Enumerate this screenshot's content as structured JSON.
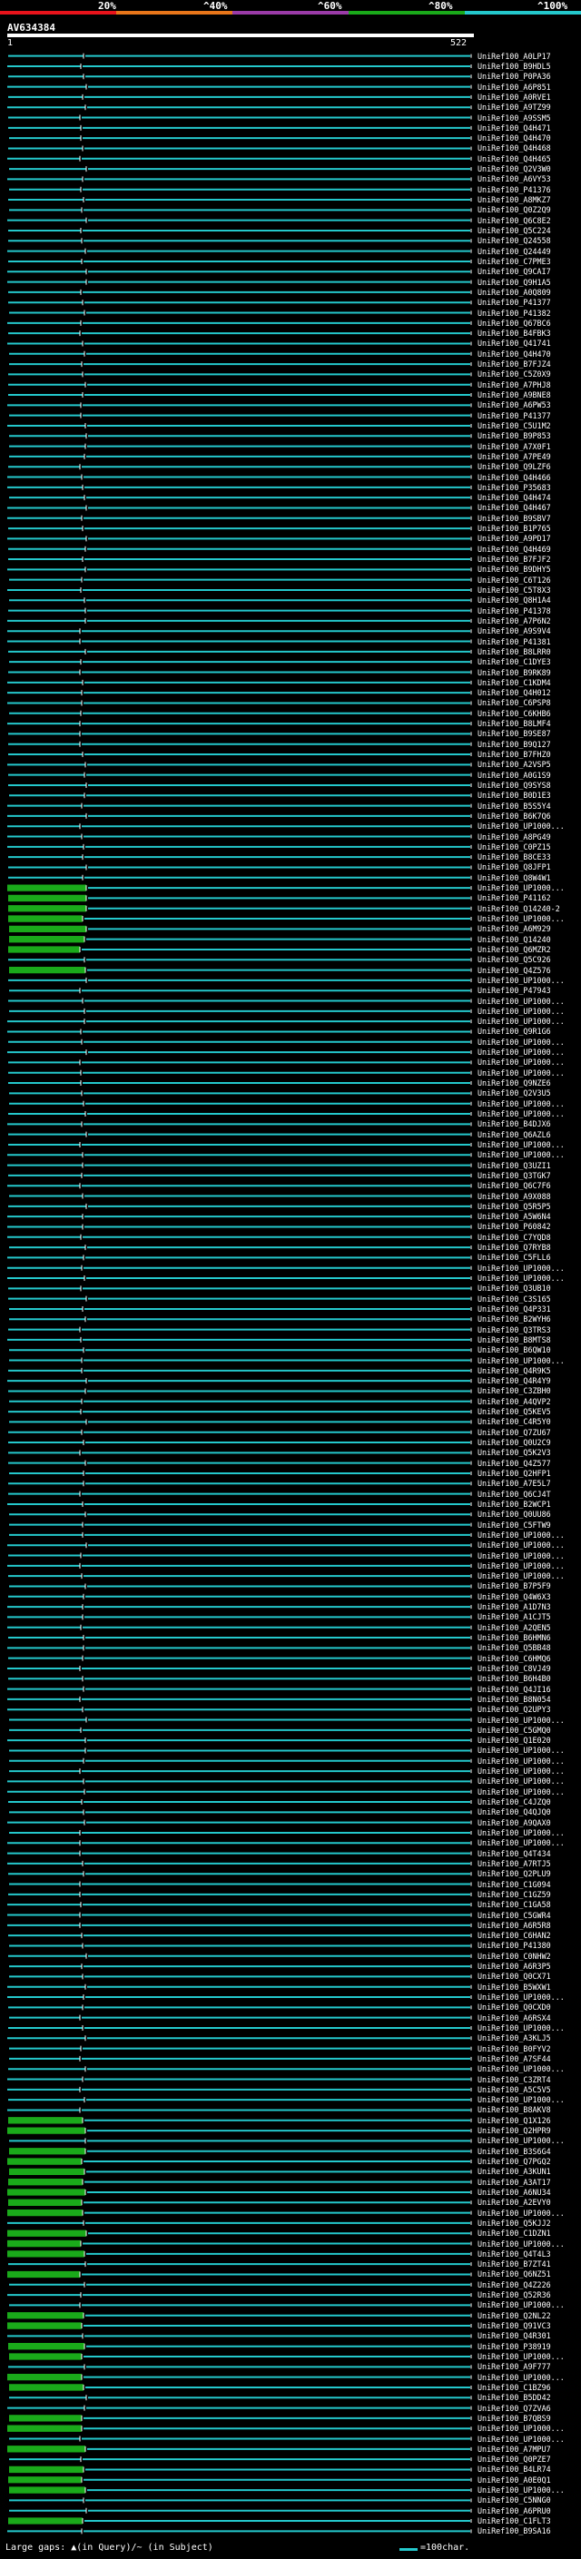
{
  "legend": {
    "ticks": [
      "20%",
      "^40%",
      "^60%",
      "^80%",
      "^100%"
    ],
    "colors": [
      "#e8131b",
      "#e8761a",
      "#9b3ba8",
      "#1aaa1a",
      "#24c8cc"
    ]
  },
  "query": {
    "name": "AV634384",
    "start": "1",
    "end": "522"
  },
  "hits": [
    "UniRef100_A0LP17",
    "UniRef100_B9HDL5",
    "UniRef100_P0PA36",
    "UniRef100_A6P851",
    "UniRef100_A0RVE1",
    "UniRef100_A9TZ99",
    "UniRef100_A9SSM5",
    "UniRef100_Q4H471",
    "UniRef100_Q4H470",
    "UniRef100_Q4H468",
    "UniRef100_Q4H465",
    "UniRef100_Q2V3W0",
    "UniRef100_A6VY53",
    "UniRef100_P41376",
    "UniRef100_A8MKZ7",
    "UniRef100_Q0Z2Q9",
    "UniRef100_Q6C8E2",
    "UniRef100_Q5C224",
    "UniRef100_Q24558",
    "UniRef100_Q24449",
    "UniRef100_C7PME3",
    "UniRef100_Q9CAI7",
    "UniRef100_Q9H1A5",
    "UniRef100_A0Q809",
    "UniRef100_P41377",
    "UniRef100_P41382",
    "UniRef100_Q67BC6",
    "UniRef100_B4FBK3",
    "UniRef100_Q41741",
    "UniRef100_Q4H470",
    "UniRef100_B7FJZ4",
    "UniRef100_C5Z0X9",
    "UniRef100_A7PHJ8",
    "UniRef100_A9BNE8",
    "UniRef100_A6PW53",
    "UniRef100_P41377",
    "UniRef100_C5U1M2",
    "UniRef100_B9P853",
    "UniRef100_A7X0F1",
    "UniRef100_A7PE49",
    "UniRef100_Q9LZF6",
    "UniRef100_Q4H466",
    "UniRef100_P35683",
    "UniRef100_Q4H474",
    "UniRef100_Q4H467",
    "UniRef100_B9SBV7",
    "UniRef100_B1P765",
    "UniRef100_A9PD17",
    "UniRef100_Q4H469",
    "UniRef100_B7FJF2",
    "UniRef100_B9DHY5",
    "UniRef100_C6T126",
    "UniRef100_C5T8X3",
    "UniRef100_Q8H1A4",
    "UniRef100_P41378",
    "UniRef100_A7P6N2",
    "UniRef100_A9S9V4",
    "UniRef100_P41381",
    "UniRef100_B8LRR0",
    "UniRef100_C1DYE3",
    "UniRef100_B9RK89",
    "UniRef100_C1KDM4",
    "UniRef100_Q4H012",
    "UniRef100_C6PSP8",
    "UniRef100_C6KHB6",
    "UniRef100_B8LMF4",
    "UniRef100_B9SE87",
    "UniRef100_B9Q127",
    "UniRef100_B7FHZ0",
    "UniRef100_A2VSP5",
    "UniRef100_A0G1S9",
    "UniRef100_Q9SYS8",
    "UniRef100_B0D1E3",
    "UniRef100_B5S5Y4",
    "UniRef100_B6K7Q6",
    "UniRef100_UP1000...",
    "UniRef100_A8PG49",
    "UniRef100_C0PZ15",
    "UniRef100_B8CE33",
    "UniRef100_Q8JFP1",
    "UniRef100_Q8W4W1",
    "UniRef100_UP1000...",
    "UniRef100_P41162",
    "UniRef100_Q14240-2",
    "UniRef100_UP1000...",
    "UniRef100_A6M929",
    "UniRef100_Q14240",
    "UniRef100_Q6MZR2",
    "UniRef100_Q5C926",
    "UniRef100_Q4Z576",
    "UniRef100_UP1000...",
    "UniRef100_P47943",
    "UniRef100_UP1000...",
    "UniRef100_UP1000...",
    "UniRef100_UP1000...",
    "UniRef100_Q9R1G6",
    "UniRef100_UP1000...",
    "UniRef100_UP1000...",
    "UniRef100_UP1000...",
    "UniRef100_UP1000...",
    "UniRef100_Q9NZE6",
    "UniRef100_Q2V3U5",
    "UniRef100_UP1000...",
    "UniRef100_UP1000...",
    "UniRef100_B4DJX6",
    "UniRef100_Q6AZL6",
    "UniRef100_UP1000...",
    "UniRef100_UP1000...",
    "UniRef100_Q3UZI1",
    "UniRef100_Q3TGK7",
    "UniRef100_Q6C7F6",
    "UniRef100_A9X088",
    "UniRef100_Q5R5P5",
    "UniRef100_A5W6N4",
    "UniRef100_P60842",
    "UniRef100_C7YQD8",
    "UniRef100_Q7RYB8",
    "UniRef100_C5FLL6",
    "UniRef100_UP1000...",
    "UniRef100_UP1000...",
    "UniRef100_Q3UB10",
    "UniRef100_C3S165",
    "UniRef100_Q4P331",
    "UniRef100_B2WYH6",
    "UniRef100_Q3TRS3",
    "UniRef100_B8MTS8",
    "UniRef100_B6QW10",
    "UniRef100_UP1000...",
    "UniRef100_Q4R9K5",
    "UniRef100_Q4R4Y9",
    "UniRef100_C3ZBH0",
    "UniRef100_A4QVP2",
    "UniRef100_Q5KEV5",
    "UniRef100_C4R5Y0",
    "UniRef100_Q7ZU67",
    "UniRef100_Q0U2C9",
    "UniRef100_Q5K2V3",
    "UniRef100_Q4Z577",
    "UniRef100_Q2HFP1",
    "UniRef100_A7E5L7",
    "UniRef100_Q6CJ4T",
    "UniRef100_B2WCP1",
    "UniRef100_Q0UU86",
    "UniRef100_C5FTW9",
    "UniRef100_UP1000...",
    "UniRef100_UP1000...",
    "UniRef100_UP1000...",
    "UniRef100_UP1000...",
    "UniRef100_UP1000...",
    "UniRef100_B7P5F9",
    "UniRef100_Q4W6X3",
    "UniRef100_A1D7N3",
    "UniRef100_A1CJT5",
    "UniRef100_A2QEN5",
    "UniRef100_B6HMN6",
    "UniRef100_Q5BB48",
    "UniRef100_C6HMQ6",
    "UniRef100_C8VJ49",
    "UniRef100_B6H4B0",
    "UniRef100_Q4JI16",
    "UniRef100_B8N054",
    "UniRef100_Q2UPY3",
    "UniRef100_UP1000...",
    "UniRef100_C5GMQ0",
    "UniRef100_Q1E020",
    "UniRef100_UP1000...",
    "UniRef100_UP1000...",
    "UniRef100_UP1000...",
    "UniRef100_UP1000...",
    "UniRef100_UP1000...",
    "UniRef100_C4JZQ0",
    "UniRef100_Q4QJQ0",
    "UniRef100_A9QAX0",
    "UniRef100_UP1000...",
    "UniRef100_UP1000...",
    "UniRef100_Q4T434",
    "UniRef100_A7RTJ5",
    "UniRef100_Q2PLU9",
    "UniRef100_C1G094",
    "UniRef100_C1GZ59",
    "UniRef100_C1GA58",
    "UniRef100_C5GWR4",
    "UniRef100_A6R5R8",
    "UniRef100_C6HAN2",
    "UniRef100_P41380",
    "UniRef100_C0NHW2",
    "UniRef100_A6R3P5",
    "UniRef100_Q0CX71",
    "UniRef100_B5WXW1",
    "UniRef100_UP1000...",
    "UniRef100_Q0CXD0",
    "UniRef100_A6RSX4",
    "UniRef100_UP1000...",
    "UniRef100_A3KLJ5",
    "UniRef100_B0FYV2",
    "UniRef100_A7SF44",
    "UniRef100_UP1000...",
    "UniRef100_C3ZRT4",
    "UniRef100_A5C5V5",
    "UniRef100_UP1000...",
    "UniRef100_B8AKV8",
    "UniRef100_Q1X126",
    "UniRef100_Q2HPR9",
    "UniRef100_UP1000...",
    "UniRef100_B3S6G4",
    "UniRef100_Q7PGQ2",
    "UniRef100_A3KUN1",
    "UniRef100_A3AT17",
    "UniRef100_A6NU34",
    "UniRef100_A2EVY0",
    "UniRef100_UP1000...",
    "UniRef100_Q5KJJ2",
    "UniRef100_C1DZN1",
    "UniRef100_UP1000...",
    "UniRef100_Q4T4L3",
    "UniRef100_B7ZT41",
    "UniRef100_Q6NZ51",
    "UniRef100_Q4Z226",
    "UniRef100_Q52R36",
    "UniRef100_UP1000...",
    "UniRef100_Q2NL22",
    "UniRef100_Q91VC3",
    "UniRef100_Q4R301",
    "UniRef100_P38919",
    "UniRef100_UP1000...",
    "UniRef100_A9F777",
    "UniRef100_UP1000...",
    "UniRef100_C1BZ96",
    "UniRef100_B5DD42",
    "UniRef100_Q7ZVA6",
    "UniRef100_B7QBS9",
    "UniRef100_UP1000...",
    "UniRef100_UP1000...",
    "UniRef100_A7MPU7",
    "UniRef100_Q0PZE7",
    "UniRef100_B4LR74",
    "UniRef100_A0E0Q1",
    "UniRef100_UP1000...",
    "UniRef100_C5NNG0",
    "UniRef100_A6PRU0",
    "UniRef100_C1FLT3",
    "UniRef100_B9SA16"
  ],
  "footer": {
    "gaps_text": "Large gaps: ▲(in Query)/~ (in Subject)",
    "scale_text": "=100char."
  }
}
